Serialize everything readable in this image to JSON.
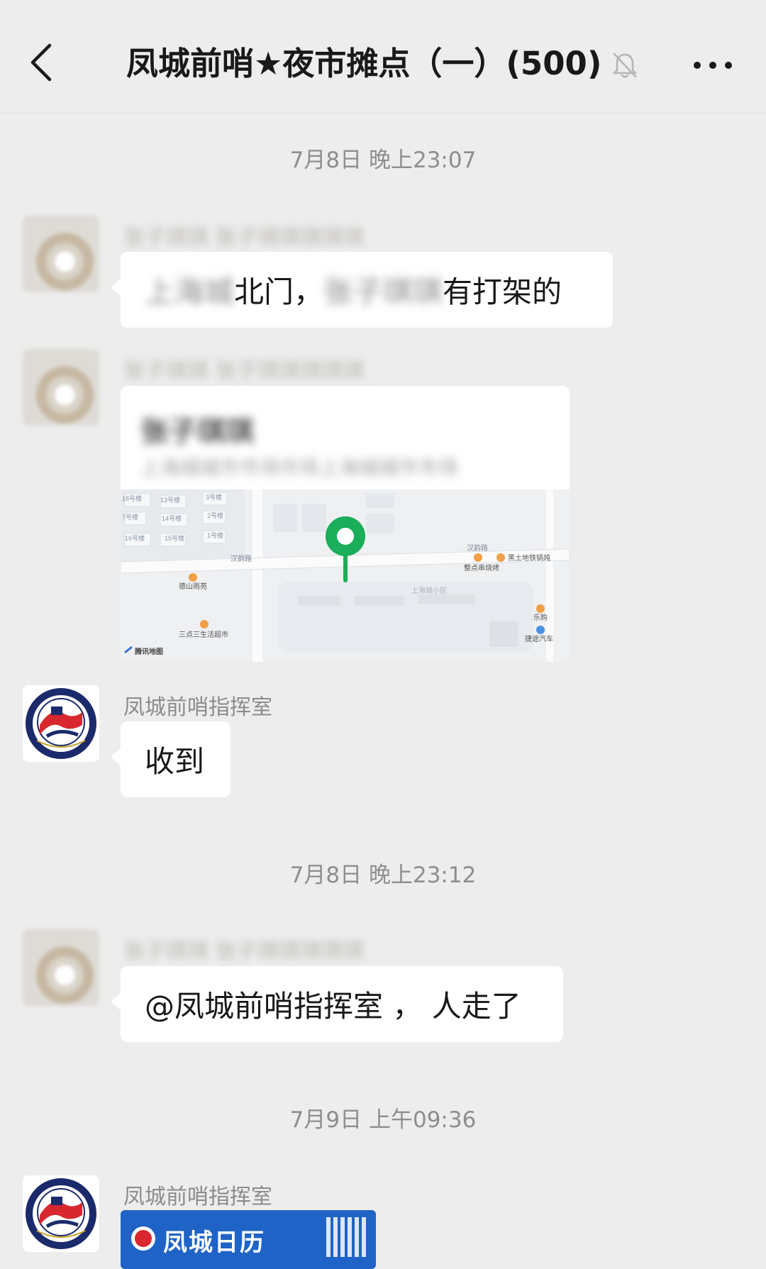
{
  "header": {
    "title": "凤城前哨★夜市摊点（一）(500)",
    "back_icon": "chevron-left-icon",
    "mute_icon": "bell-off-icon",
    "more_icon": "ellipsis-icon"
  },
  "messages": [
    {
      "timestamp": "7月8日 晚上23:07"
    },
    {
      "sender": "张子琪琪 张子琪琪琪琪琪",
      "text_parts": [
        "上海城",
        "北门，",
        "张子琪琪",
        "有打架的"
      ]
    },
    {
      "sender": "张子琪琪 张子琪琪琪琪琪",
      "location": {
        "name": "张子琪琪",
        "address": "上海城城市市场市场上海城城市市场",
        "map_labels": {
          "road1": "汉韵路",
          "road2": "汉韵路",
          "poi1": "德山雨苑",
          "poi2": "黑土地铁锅炖",
          "poi3": "整点串烧烤",
          "area": "上海城小区",
          "poi4": "乐购",
          "poi5": "捷途汽车",
          "poi6": "三点三生活超市",
          "provider": "腾讯地图",
          "b1": "18号楼",
          "b2": "13号楼",
          "b3": "3号楼",
          "b4": "7号楼",
          "b5": "14号楼",
          "b6": "2号楼",
          "b7": "16号楼",
          "b8": "15号楼",
          "b9": "1号楼"
        }
      }
    },
    {
      "sender": "凤城前哨指挥室",
      "text": "收到"
    },
    {
      "timestamp": "7月8日 晚上23:12"
    },
    {
      "sender": "张子琪琪 张子琪琪琪琪琪",
      "text": "@凤城前哨指挥室 ， 人走了"
    },
    {
      "timestamp": "7月9日 上午09:36"
    },
    {
      "sender": "凤城前哨指挥室",
      "image_text": "凤城日历"
    }
  ],
  "colors": {
    "background": "#ededed",
    "bubble": "#ffffff",
    "map_pin": "#1aad5a",
    "logo_navy": "#1b2a6b",
    "logo_red": "#d8272e"
  }
}
